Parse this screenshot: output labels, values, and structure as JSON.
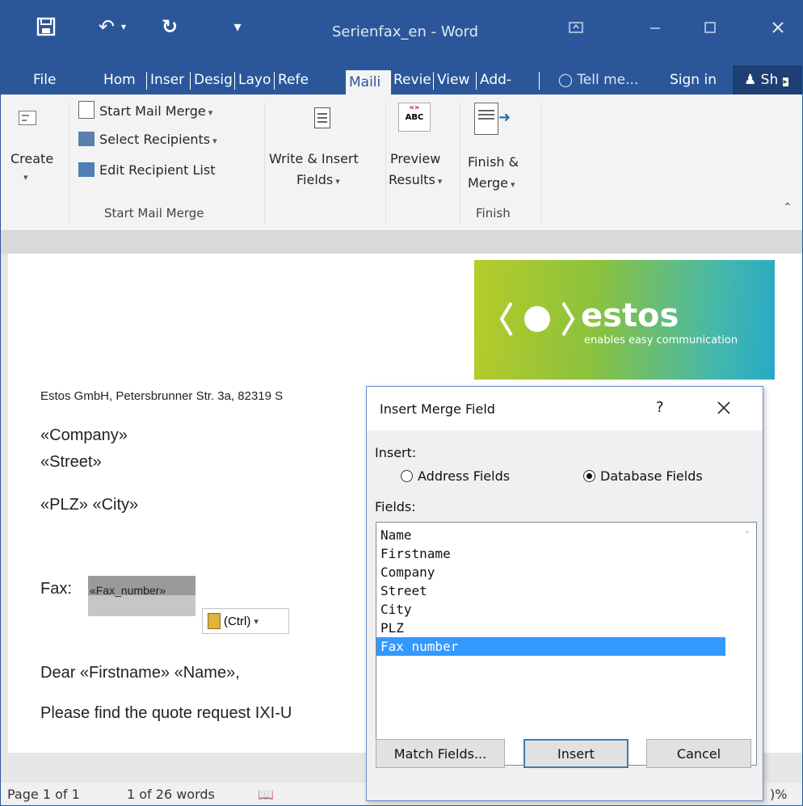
{
  "window": {
    "title": "Serienfax_en - Word"
  },
  "ribbon_tabs": [
    {
      "label": "File"
    },
    {
      "label": "Hom"
    },
    {
      "label": "Inser"
    },
    {
      "label": "Desig"
    },
    {
      "label": "Layo"
    },
    {
      "label": "Refe"
    },
    {
      "label": "Maili"
    },
    {
      "label": "Revie"
    },
    {
      "label": "View"
    },
    {
      "label": "Add-"
    }
  ],
  "tell_me": "Tell me...",
  "sign_in": "Sign in",
  "share": "Sh",
  "ribbon": {
    "create": {
      "label": "Create"
    },
    "start_mail_merge": "Start Mail Merge",
    "select_recipients": "Select Recipients",
    "edit_recipient_list": "Edit Recipient List",
    "group_start": "Start Mail Merge",
    "write_insert_line1": "Write & Insert",
    "write_insert_line2": "Fields",
    "preview_line1": "Preview",
    "preview_line2": "Results",
    "finish_line1": "Finish &",
    "finish_line2": "Merge",
    "group_finish": "Finish"
  },
  "document": {
    "sender": "Estos GmbH, Petersbrunner Str.  3a, 82319 S",
    "company": "«Company»",
    "street": "«Street»",
    "plz_city": "«PLZ» «City»",
    "fax_label": "Fax:",
    "fax_field": "«Fax_number»",
    "paste_ctrl": "(Ctrl)",
    "greeting": "Dear «Firstname» «Name»,",
    "body": "Please find the quote request IXI-U",
    "logo_main": "estos",
    "logo_sub": "enables easy communication"
  },
  "dialog": {
    "title": "Insert Merge Field",
    "help": "?",
    "insert_label": "Insert:",
    "address_fields": "Address Fields",
    "database_fields": "Database Fields",
    "fields_label": "Fields:",
    "fields": [
      "Name",
      "Firstname",
      "Company",
      "Street",
      "City",
      "PLZ",
      "Fax number"
    ],
    "selected_index": 6,
    "match_fields": "Match Fields...",
    "insert": "Insert",
    "cancel": "Cancel"
  },
  "status": {
    "page": "Page 1 of 1",
    "words": "1 of 26 words",
    "zoom_partial": ")%"
  },
  "colors": {
    "title_bar": "#2b579a",
    "selection": "#3399ff"
  }
}
